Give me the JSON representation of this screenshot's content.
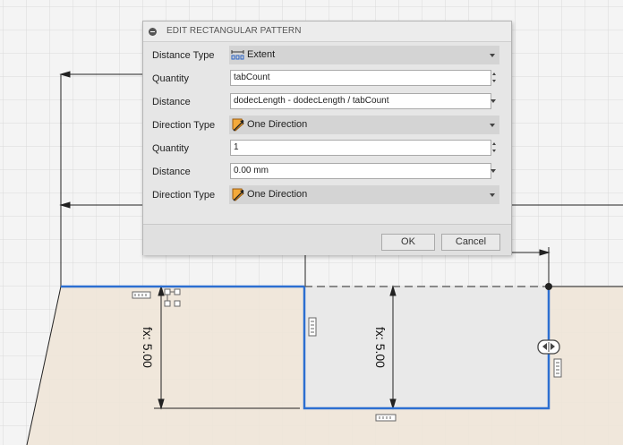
{
  "dialog": {
    "title": "EDIT RECTANGULAR PATTERN",
    "rows": [
      {
        "label": "Distance Type",
        "control": "dropdown",
        "value": "Extent",
        "icon": "extent-icon"
      },
      {
        "label": "Quantity",
        "control": "spinner",
        "value": "tabCount"
      },
      {
        "label": "Distance",
        "control": "expression-input",
        "value": "dodecLength - dodecLength / tabCount"
      },
      {
        "label": "Direction Type",
        "control": "dropdown",
        "value": "One Direction",
        "icon": "one-direction-icon"
      },
      {
        "label": "Quantity",
        "control": "spinner",
        "value": "1"
      },
      {
        "label": "Distance",
        "control": "expression-input",
        "value": "0.00 mm"
      },
      {
        "label": "Direction Type",
        "control": "dropdown",
        "value": "One Direction",
        "icon": "one-direction-icon"
      }
    ],
    "ok_label": "OK",
    "cancel_label": "Cancel"
  },
  "sketch": {
    "dimension_left": "fx: 5.00",
    "dimension_right": "fx: 5.00"
  },
  "colors": {
    "profile_blue": "#2c6fd1",
    "region_fill": "#ece4d8",
    "grid_line": "#d9d9d9",
    "dialog_bg": "#e6e6e6"
  }
}
